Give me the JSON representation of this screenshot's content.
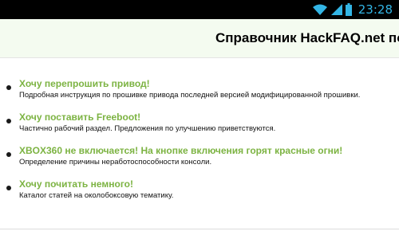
{
  "status_bar": {
    "time": "23:28",
    "clock_color": "#33b5e5",
    "icons": [
      "wifi-icon",
      "signal-icon",
      "battery-icon"
    ]
  },
  "header": {
    "title": "Справочник HackFAQ.net по X"
  },
  "theme": {
    "accent": "#7cb342",
    "header_background": "#f4fbf0"
  },
  "list": {
    "items": [
      {
        "title": "Хочу перепрошить привод!",
        "description": "Подробная инструкция по прошивке привода последней версией модифицированной прошивки."
      },
      {
        "title": "Хочу поставить Freeboot!",
        "description": "Частично рабочий раздел. Предложения по улучшению приветствуются."
      },
      {
        "title": "XBOX360 не включается! На кнопке включения горят красные огни!",
        "description": "Определение причины неработоспособности консоли."
      },
      {
        "title": "Хочу почитать немного!",
        "description": "Каталог статей на околобоксовую тематику."
      }
    ]
  }
}
